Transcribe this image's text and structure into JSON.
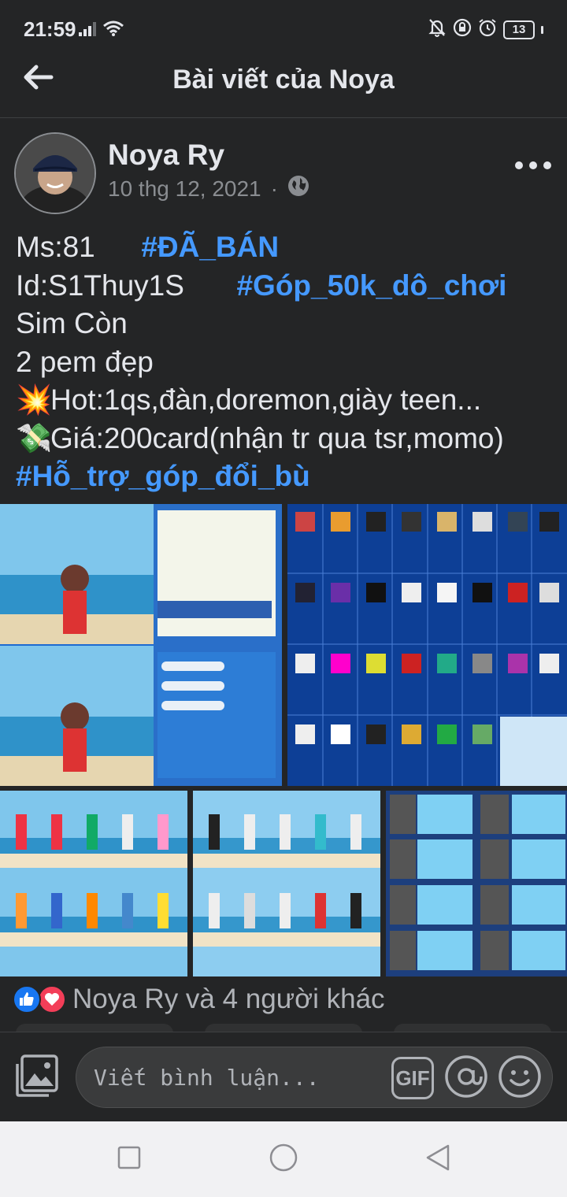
{
  "status_bar": {
    "time": "21:59",
    "battery": "13",
    "icons": [
      "signal-icon",
      "wifi-icon",
      "mute-bell-icon",
      "lock-rotation-icon",
      "alarm-icon",
      "battery-icon"
    ]
  },
  "header": {
    "title": "Bài viết của Noya",
    "back_icon": "arrow-left-icon"
  },
  "post": {
    "author": "Noya Ry",
    "date": "10 thg 12, 2021",
    "separator": "·",
    "privacy_icon": "globe-icon",
    "lines": {
      "l1_text": "Ms:81",
      "l1_tag": "#ĐÃ_BÁN",
      "l2_text": "Id:S1Thuy1S",
      "l2_tag": "#Góp_50k_dô_chơi",
      "l3_text": "Sim Còn",
      "l4_text": "2 pem đẹp",
      "l5_emoji": "💥",
      "l5_text": "Hot:1qs,đàn,doremon,giày teen...",
      "l6_emoji": "💸",
      "l6_text": "Giá:200card(nhận tr qua tsr,momo)",
      "l7_tag": "#Hỗ_trợ_góp_đổi_bù"
    }
  },
  "reactions": {
    "text": "Noya Ry và 4 người khác"
  },
  "comment_bar": {
    "placeholder": "Viết bình luận...",
    "gif_label": "GIF"
  },
  "nav_bar": {
    "icons": [
      "recents-square-icon",
      "home-circle-icon",
      "back-triangle-icon"
    ]
  },
  "colors": {
    "background": "#242526",
    "text": "#e4e6eb",
    "hashtag": "#4599ff",
    "secondary_text": "#8a8d91",
    "like_blue": "#1877f2",
    "love_red": "#f33e58"
  }
}
